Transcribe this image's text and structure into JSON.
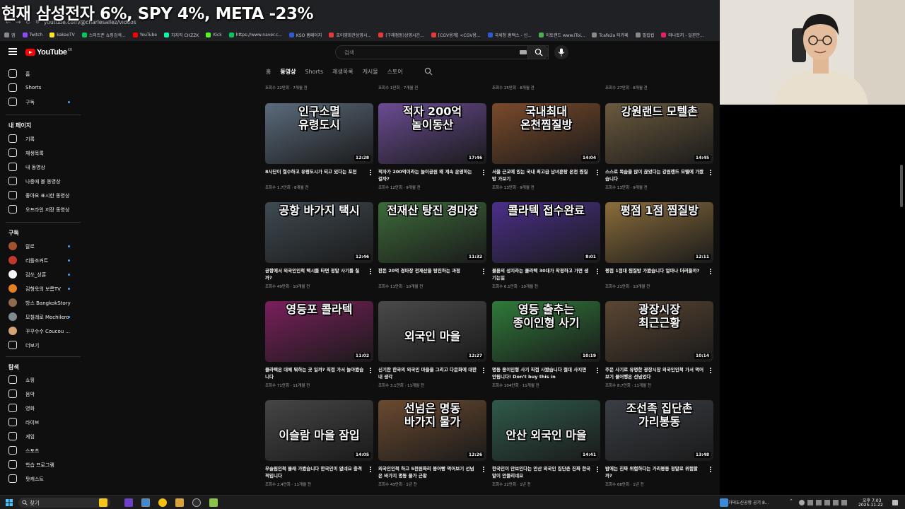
{
  "overlay": {
    "title": "현재 삼성전자 6%, SPY 4%, META -23%"
  },
  "browser": {
    "url": "youtube.com/@charlesallez/videos",
    "bookmarks": [
      {
        "label": "앱",
        "color": "#888"
      },
      {
        "label": "Twitch",
        "color": "#9146ff"
      },
      {
        "label": "kakaoTV",
        "color": "#ffe812"
      },
      {
        "label": "스마트폰 쇼핑검색...",
        "color": "#03c75a"
      },
      {
        "label": "YouTube",
        "color": "#ff0000"
      },
      {
        "label": "치지직 CHZZK",
        "color": "#00ffa3"
      },
      {
        "label": "Kick",
        "color": "#53fc18"
      },
      {
        "label": "https://www.naver.c...",
        "color": "#03c75a"
      },
      {
        "label": "KSO 홈페이지",
        "color": "#2a5bd7"
      },
      {
        "label": "호이영화관상영시...",
        "color": "#e53935"
      },
      {
        "label": "(구래점동)상영시간...",
        "color": "#e53935"
      },
      {
        "label": "[CGV용계] <CGV용...",
        "color": "#e53935"
      },
      {
        "label": "국세청 홈택스 - 신...",
        "color": "#2a5bd7"
      },
      {
        "label": "이토랜드 www.iToi...",
        "color": "#4caf50"
      },
      {
        "label": "Tcafe2a 티카페",
        "color": "#888"
      },
      {
        "label": "필립컵",
        "color": "#888"
      },
      {
        "label": "마나토끼 - 일본만...",
        "color": "#e91e63"
      }
    ]
  },
  "youtube": {
    "logo_text": "YouTube",
    "logo_region": "KR",
    "search_placeholder": "검색",
    "sidebar": {
      "top": [
        {
          "name": "home",
          "label": "홈"
        },
        {
          "name": "shorts",
          "label": "Shorts"
        },
        {
          "name": "subscriptions",
          "label": "구독"
        }
      ],
      "my_heading": "내 페이지",
      "my": [
        {
          "name": "history",
          "label": "기록"
        },
        {
          "name": "playlists",
          "label": "재생목록"
        },
        {
          "name": "my-videos",
          "label": "내 동영상"
        },
        {
          "name": "watch-later",
          "label": "나중에 볼 동영상"
        },
        {
          "name": "liked",
          "label": "좋아요 표시한 동영상"
        },
        {
          "name": "downloads",
          "label": "오프라인 저장 동영상"
        }
      ],
      "subs_heading": "구독",
      "subs": [
        {
          "label": "랄로",
          "color": "#a0522d"
        },
        {
          "label": "리틀조커트",
          "color": "#c0392b"
        },
        {
          "label": "김쏘_상훈",
          "color": "#f5f5f5"
        },
        {
          "label": "김형욱의 보름TV",
          "color": "#e67e22"
        },
        {
          "label": "방스 BangkokStory",
          "color": "#8e6b4a"
        },
        {
          "label": "모칠레로 Mochilero",
          "color": "#7f8c8d"
        },
        {
          "label": "꾸꾸수수 Coucou ...",
          "color": "#d4a373"
        }
      ],
      "more_label": "더보기",
      "explore_heading": "탐색",
      "explore": [
        {
          "name": "shopping",
          "label": "쇼핑"
        },
        {
          "name": "music",
          "label": "음악"
        },
        {
          "name": "movies",
          "label": "영화"
        },
        {
          "name": "live",
          "label": "라이브"
        },
        {
          "name": "gaming",
          "label": "게임"
        },
        {
          "name": "sports",
          "label": "스포츠"
        },
        {
          "name": "learning",
          "label": "학습 프로그램"
        },
        {
          "name": "podcasts",
          "label": "팟캐스트"
        }
      ]
    },
    "tabs": [
      "홈",
      "동영상",
      "Shorts",
      "재생목록",
      "게시물",
      "스토어"
    ],
    "active_tab": "동영상",
    "partial_row_meta": [
      "조회수 22만회 · 7개월 전",
      "조회수 1만회 · 7개월 전",
      "조회수 25만회 · 8개월 전",
      "조회수 27만회 · 8개월 전"
    ],
    "videos": [
      {
        "caption": "인구소멸\n유령도시",
        "duration": "12:28",
        "title": "8사단이 철수하고 유령도시가 되고 있다는 포천",
        "meta": "조회수 1.7만회 · 8개월 전",
        "bg": "#5b6b7c"
      },
      {
        "caption": "적자 200억\n놀이동산",
        "duration": "17:46",
        "title": "적자가 200억이라는 놀이공원 왜 계속 운영하는 걸까?",
        "meta": "조회수 12만회 · 9개월 전",
        "bg": "#6a4c93"
      },
      {
        "caption": "국내최대\n온천찜질방",
        "duration": "14:04",
        "title": "서울 근교에 있는 국내 최고급 남녀혼탕 온천 찜질방 가보기",
        "meta": "조회수 13만회 · 9개월 전",
        "bg": "#7a4b2a"
      },
      {
        "caption": "강원랜드 모텔촌",
        "duration": "14:45",
        "title": "스스로 목숨을 많이 끊었다는 강원랜드 모텔에 가봤습니다",
        "meta": "조회수 13만회 · 9개월 전",
        "bg": "#6b5a3e"
      },
      {
        "caption": "공항 바가지 택시",
        "duration": "12:46",
        "title": "공항에서 외국인인척 택시를 타면 정말 사기를 칠까?",
        "meta": "조회수 49만회 · 10개월 전",
        "bg": "#3f4a52"
      },
      {
        "caption": "전재산 탕진 경마장",
        "duration": "11:32",
        "title": "판돈 20억 경마장 전재산을 탕진하는 과정",
        "meta": "조회수 11만회 · 10개월 전",
        "bg": "#3d6b3a"
      },
      {
        "caption": "콜라텍 접수완료",
        "duration": "8:01",
        "title": "불륜의 성지라는 콜라텍 30대가 작정하고 가면 생기는일",
        "meta": "조회수 6.1만회 · 10개월 전",
        "bg": "#4b2f8a"
      },
      {
        "caption": "평점 1점 찜질방",
        "duration": "12:11",
        "title": "평점 1점대 찜질방 가봤습니다 얼마나 더러울까?",
        "meta": "조회수 21만회 · 10개월 전",
        "bg": "#8a6d3b"
      },
      {
        "caption": "영등포 콜라텍",
        "duration": "11:02",
        "title": "콜라텍은 대체 뭐하는 곳 일까? 직접 가서 놀아봤습니다",
        "meta": "조회수 71만회 · 11개월 전",
        "bg": "#7a1f5c"
      },
      {
        "caption": "\n\n외국인 마을",
        "duration": "12:27",
        "title": "신기한 한국의 외국인 마을을 그리고 다문화에 대한 내 생각",
        "meta": "조회수 3.1만회 · 11개월 전",
        "bg": "#4a4a4a"
      },
      {
        "caption": "영등 출추는\n종이인형 사기",
        "duration": "10:19",
        "title": "명동 종이인형 사기 직접 사봤습니다 절대 사지면 안됩니다! Don't buy this in Myeongdong!",
        "meta": "조회수 104만회 · 11개월 전",
        "bg": "#2f7a3a"
      },
      {
        "caption": "광장시장\n최근근황",
        "duration": "10:14",
        "title": "주문 사기로 유명한 광장시장 외국인인척 가서 먹어보기 불어행은 선넘었다",
        "meta": "조회수 8.7만회 · 11개월 전",
        "bg": "#5a4632"
      },
      {
        "caption": "\n\n이슬람 마을 잠입",
        "duration": "14:05",
        "title": "무슬림인척 몰래 가봤습니다 한국인이 없네요 충격적입니다",
        "meta": "조회수 2.4만회 · 11개월 전",
        "bg": "#454545"
      },
      {
        "caption": "선넘은 명동\n바가지 물가",
        "duration": "12:26",
        "title": "외국인인척 하고 5천원짜리 붕어빵 먹어보기 선넘은 바가지 명동 물가 근황",
        "meta": "조회수 43만회 · 1년 전",
        "bg": "#6b4a2f"
      },
      {
        "caption": "\n\n안산 외국인 마을",
        "duration": "14:41",
        "title": "한국인이 안보인다는 안산 외국인 집단촌 진짜 한국말이 안들리네요",
        "meta": "조회수 22만회 · 1년 전",
        "bg": "#2f5a4a"
      },
      {
        "caption": "조선족 집단촌\n가리봉동",
        "duration": "13:48",
        "title": "밤에는 진짜 위험하다는 가리봉동 정말로 위험할까?",
        "meta": "조회수 68만회 · 1년 전",
        "bg": "#3a3f45"
      }
    ]
  },
  "taskbar": {
    "search_label": "찾기",
    "window_title": "가덕도신공항 공기 8...",
    "time": "오후 7:03",
    "date": "2025-11-22"
  }
}
